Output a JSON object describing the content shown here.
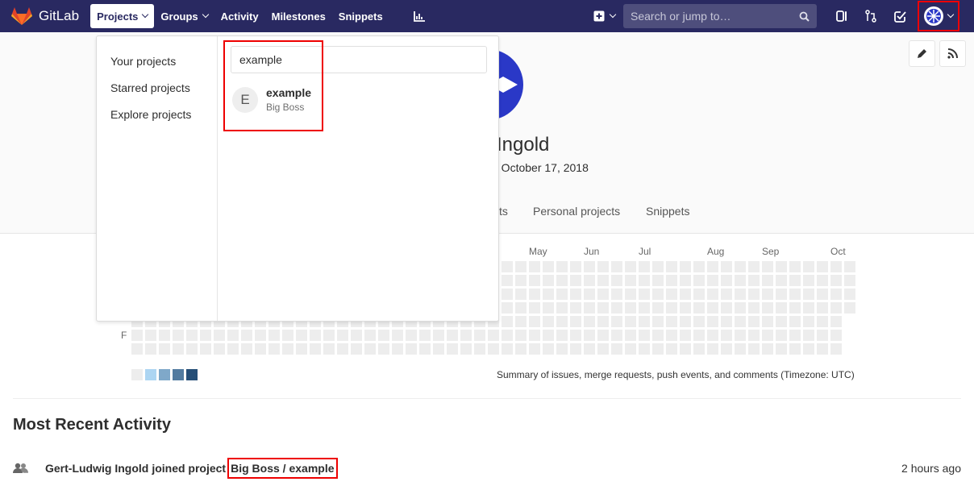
{
  "nav": {
    "brand": "GitLab",
    "links": [
      {
        "label": "Projects",
        "active": true,
        "dropdown": true
      },
      {
        "label": "Groups",
        "active": false,
        "dropdown": true
      },
      {
        "label": "Activity",
        "active": false,
        "dropdown": false
      },
      {
        "label": "Milestones",
        "active": false,
        "dropdown": false
      },
      {
        "label": "Snippets",
        "active": false,
        "dropdown": false
      }
    ],
    "search_placeholder": "Search or jump to…",
    "icons": [
      "chart-icon",
      "plus-icon",
      "issues-icon",
      "merge-request-icon",
      "todo-icon",
      "avatar"
    ],
    "bar_color": "#292961"
  },
  "profile": {
    "name_visible": "g Ingold",
    "member_since_visible": "e October 17, 2018",
    "tabs_visible": [
      "ts",
      "Personal projects",
      "Snippets"
    ]
  },
  "calendar": {
    "months": [
      "May",
      "Jun",
      "Jul",
      "Aug",
      "Sep",
      "Oct"
    ],
    "day_label": "F",
    "summary": "Summary of issues, merge requests, push events, and comments (Timezone: UTC)",
    "legend_colors": [
      "#ededed",
      "#acd5f2",
      "#7fa8c9",
      "#527ba0",
      "#254e77"
    ]
  },
  "activity": {
    "heading": "Most Recent Activity",
    "items": [
      {
        "user": "Gert-Ludwig Ingold",
        "action": "joined project",
        "project": "Big Boss / example",
        "time": "2 hours ago"
      }
    ]
  },
  "projects_dropdown": {
    "menu": [
      "Your projects",
      "Starred projects",
      "Explore projects"
    ],
    "search_value": "example",
    "results": [
      {
        "initial": "E",
        "name": "example",
        "namespace": "Big Boss"
      }
    ]
  }
}
